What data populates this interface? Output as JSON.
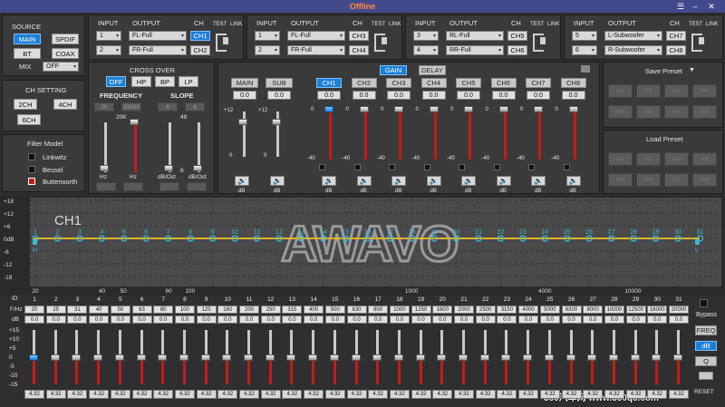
{
  "window": {
    "title": "Offline",
    "menu_icon": "hamburger-icon",
    "minimize_icon": "minimize-icon",
    "close_icon": "close-icon"
  },
  "source": {
    "title": "SOURCE",
    "buttons": [
      "MAIN",
      "SPDIF",
      "BT",
      "COAX"
    ],
    "selected": "MAIN",
    "mix_label": "MIX",
    "mix_value": "OFF"
  },
  "ch_setting": {
    "title": "CH SETTING",
    "buttons": [
      "2CH",
      "4CH",
      "6CH"
    ]
  },
  "filter_model": {
    "title": "Filter Model",
    "items": [
      "Linkwitz",
      "Bessel",
      "Butterworth"
    ],
    "selected": "Butterworth"
  },
  "routing": {
    "headers": {
      "input": "INPUT",
      "output": "OUTPUT",
      "ch": "CH",
      "test": "TEST",
      "link": "LINK"
    },
    "groups": [
      {
        "rows": [
          {
            "input": "1",
            "output": "FL-Full",
            "ch": "CH1"
          },
          {
            "input": "2",
            "output": "FR-Full",
            "ch": "CH2"
          }
        ],
        "selected": "CH1"
      },
      {
        "rows": [
          {
            "input": "1",
            "output": "FL-Full",
            "ch": "CH3"
          },
          {
            "input": "2",
            "output": "FR-Full",
            "ch": "CH4"
          }
        ],
        "selected": ""
      },
      {
        "rows": [
          {
            "input": "3",
            "output": "RL-Full",
            "ch": "CH5"
          },
          {
            "input": "4",
            "output": "RR-Full",
            "ch": "CH6"
          }
        ],
        "selected": ""
      },
      {
        "rows": [
          {
            "input": "5",
            "output": "L-Subwoofer",
            "ch": "CH7"
          },
          {
            "input": "6",
            "output": "R-Subwoofer",
            "ch": "CH8"
          }
        ],
        "selected": ""
      }
    ]
  },
  "crossover": {
    "title": "CROSS OVER",
    "modes": [
      "OFF",
      "HP",
      "BP",
      "LP"
    ],
    "selected": "OFF",
    "frequency_label": "FREQUENCY",
    "slope_label": "SLOPE",
    "freq_values": [
      "20",
      "20000"
    ],
    "slope_values": [
      "6",
      "6"
    ],
    "scale_top": "20K",
    "scale_top2": "48",
    "unit_hz": "Hz",
    "unit_db_oct": "dB/Oct",
    "scale_bottom_slope": "6"
  },
  "gain": {
    "tabs": [
      "GAIN",
      "DELAY"
    ],
    "selected": "CH1",
    "main_label": "MAIN",
    "sub_label": "SUB",
    "main_value": "0.0",
    "sub_value": "0.0",
    "channels": [
      "CH1",
      "CH2",
      "CH3",
      "CH4",
      "CH5",
      "CH6",
      "CH7",
      "CH8"
    ],
    "values": [
      "0.0",
      "0.0",
      "0.0",
      "0.0",
      "0.0",
      "0.0",
      "0.0",
      "0.0"
    ],
    "master_scale": [
      "+12",
      "0",
      "-40"
    ],
    "ch_scale": [
      "0",
      "-40"
    ],
    "unit": "dB",
    "mute_icon": "speaker-icon",
    "levels_db": [
      0,
      0,
      0,
      0,
      0,
      0,
      0,
      0
    ]
  },
  "presets": {
    "save_title": "Save Preset",
    "load_title": "Load Preset",
    "save_slots": [
      "F01",
      "F02",
      "F03",
      "F04",
      "F05",
      "F06",
      "F07",
      "F08"
    ],
    "load_slots": [
      "F01",
      "F02",
      "F03",
      "F04",
      "F05",
      "F06",
      "F07",
      "F08"
    ]
  },
  "graph": {
    "channel_label": "CH1",
    "logo": "AWAVO",
    "y_ticks": [
      "+18",
      "+12",
      "+6",
      "0dB",
      "-6",
      "-12",
      "-18"
    ],
    "x_ticks": [
      "20",
      "40",
      "50",
      "80",
      "100",
      "1000",
      "4000",
      "10000"
    ],
    "band_markers": [
      "1",
      "2",
      "3",
      "4",
      "5",
      "6",
      "7",
      "8",
      "9",
      "10",
      "11",
      "12",
      "13",
      "14",
      "15",
      "16",
      "17",
      "18",
      "19",
      "20",
      "21",
      "22",
      "23",
      "24",
      "25",
      "26",
      "27",
      "28",
      "29",
      "30",
      "31"
    ],
    "hp_label": "H",
    "lp_label": "L",
    "curve_color": "#e0b12a",
    "marker_color": "#3bb8d6"
  },
  "eq": {
    "row_labels": {
      "id": "ID",
      "freq": "F/Hz",
      "db": "dB"
    },
    "ids": [
      "1",
      "2",
      "3",
      "4",
      "5",
      "6",
      "7",
      "8",
      "9",
      "10",
      "11",
      "12",
      "13",
      "14",
      "15",
      "16",
      "17",
      "18",
      "19",
      "20",
      "21",
      "22",
      "23",
      "24",
      "25",
      "26",
      "27",
      "28",
      "29",
      "30",
      "31"
    ],
    "freqs": [
      "20",
      "25",
      "31",
      "40",
      "50",
      "63",
      "80",
      "100",
      "125",
      "160",
      "200",
      "250",
      "315",
      "400",
      "500",
      "630",
      "800",
      "1000",
      "1250",
      "1600",
      "2000",
      "2500",
      "3150",
      "4000",
      "5000",
      "6300",
      "8000",
      "10000",
      "12500",
      "16000",
      "20000"
    ],
    "dbs": [
      "0.0",
      "0.0",
      "0.0",
      "0.0",
      "0.0",
      "0.0",
      "0.0",
      "0.0",
      "0.0",
      "0.0",
      "0.0",
      "0.0",
      "0.0",
      "0.0",
      "0.0",
      "0.0",
      "0.0",
      "0.0",
      "0.0",
      "0.0",
      "0.0",
      "0.0",
      "0.0",
      "0.0",
      "0.0",
      "0.0",
      "0.0",
      "0.0",
      "0.0",
      "0.0",
      "0.0"
    ],
    "q_values": [
      "4.32",
      "4.32",
      "4.32",
      "4.32",
      "4.32",
      "4.32",
      "4.32",
      "4.32",
      "4.32",
      "4.32",
      "4.32",
      "4.32",
      "4.32",
      "4.32",
      "4.32",
      "4.32",
      "4.32",
      "4.32",
      "4.32",
      "4.32",
      "4.32",
      "4.32",
      "4.32",
      "4.32",
      "4.32",
      "4.32",
      "4.32",
      "4.32",
      "4.32",
      "4.32",
      "4.32"
    ],
    "scale": [
      "+15",
      "+10",
      "+5",
      "0",
      "-5",
      "-10",
      "-15"
    ],
    "bypass_label": "Bypass",
    "mode_buttons": [
      "FREQ",
      "dB",
      "Q"
    ],
    "mode_selected": "dB",
    "reset_label": "RESET"
  },
  "watermark": {
    "text": "360汽车网 www.360qc.com"
  }
}
